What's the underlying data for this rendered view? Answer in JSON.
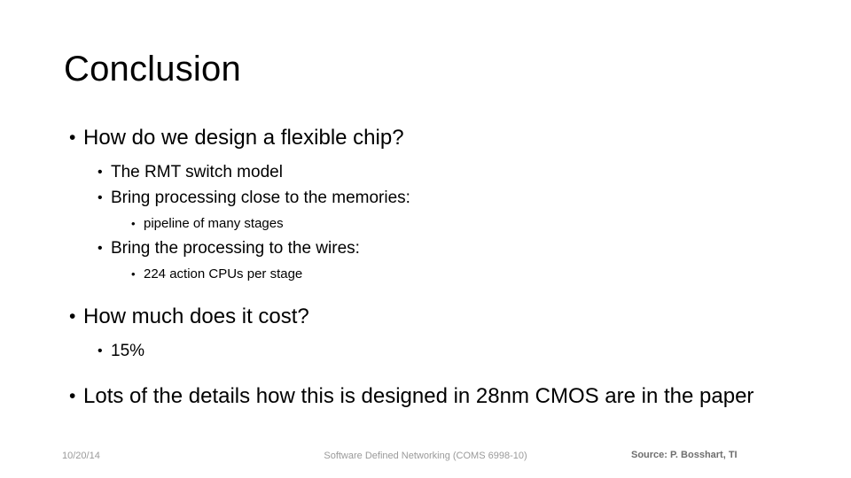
{
  "slide": {
    "title": "Conclusion",
    "background_color": "#ffffff",
    "text_color": "#000000",
    "bullet_glyph": "•",
    "content": [
      {
        "level": 1,
        "text": "How do we design a flexible chip?"
      },
      {
        "level": 2,
        "text": "The RMT switch model"
      },
      {
        "level": 2,
        "text": "Bring processing close to the memories:"
      },
      {
        "level": 3,
        "text": "pipeline of many stages"
      },
      {
        "level": 2,
        "text": "Bring the processing to the wires:"
      },
      {
        "level": 3,
        "text": "224 action CPUs per stage"
      },
      {
        "level": 1,
        "text": "How much does it cost?"
      },
      {
        "level": 2,
        "text": "15%"
      },
      {
        "level": 1,
        "text": "Lots of the details how this is designed in 28nm CMOS are in the paper"
      }
    ]
  },
  "footer": {
    "date": "10/20/14",
    "course": "Software Defined Networking (COMS 6998-10)",
    "source": "Source: P. Bosshart, TI",
    "muted_color": "#9a9a9a",
    "source_color": "#6e6e6e"
  }
}
